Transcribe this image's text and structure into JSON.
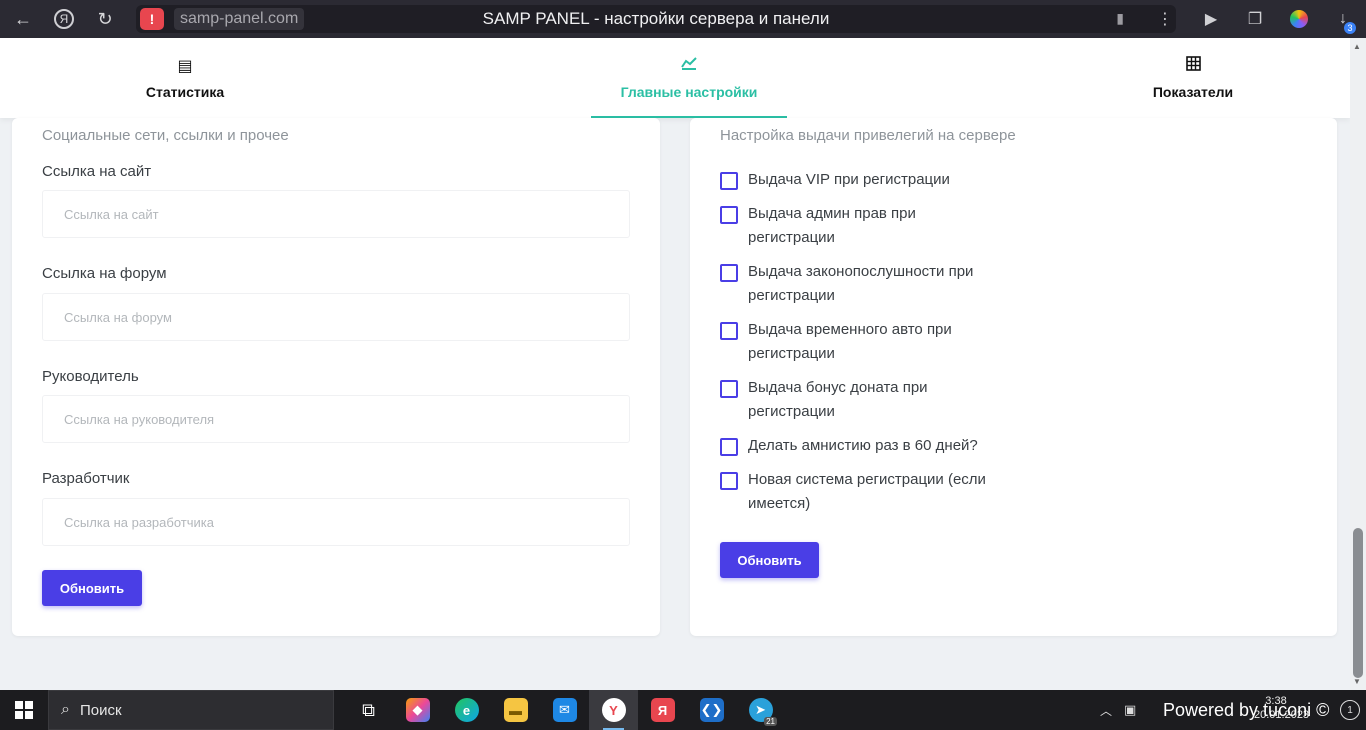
{
  "browser": {
    "url": "samp-panel.com",
    "title": "SAMP PANEL - настройки сервера и панели",
    "download_count": "3"
  },
  "tabs": [
    {
      "label": "Статистика",
      "icon": "document-icon"
    },
    {
      "label": "Главные настройки",
      "icon": "chart-icon"
    },
    {
      "label": "Показатели",
      "icon": "grid-icon"
    }
  ],
  "left_card": {
    "subtitle": "Социальные сети, ссылки и прочее",
    "fields": [
      {
        "label": "Ссылка на сайт",
        "placeholder": "Ссылка на сайт",
        "value": ""
      },
      {
        "label": "Ссылка на форум",
        "placeholder": "Ссылка на форум",
        "value": ""
      },
      {
        "label": "Руководитель",
        "placeholder": "Ссылка на руководителя",
        "value": ""
      },
      {
        "label": "Разработчик",
        "placeholder": "Ссылка на разработчика",
        "value": ""
      }
    ],
    "button_label": "Обновить"
  },
  "right_card": {
    "subtitle": "Настройка выдачи привелегий на сервере",
    "checkboxes": [
      {
        "label": "Выдача VIP при регистрации",
        "checked": false
      },
      {
        "label": "Выдача админ прав при регистрации",
        "checked": false
      },
      {
        "label": "Выдача законопослушности при регистрации",
        "checked": false
      },
      {
        "label": "Выдача временного авто при регистрации",
        "checked": false
      },
      {
        "label": "Выдача бонус доната при регистрации",
        "checked": false
      },
      {
        "label": "Делать амнистию раз в 60 дней?",
        "checked": false
      },
      {
        "label": "Новая система регистрации (если имеется)",
        "checked": false
      }
    ],
    "button_label": "Обновить"
  },
  "taskbar": {
    "search_label": "Поиск",
    "telegram_badge": "21",
    "time": "3:38",
    "date": "20.01.2023",
    "powered_text": "Powered by tuconi ©"
  }
}
